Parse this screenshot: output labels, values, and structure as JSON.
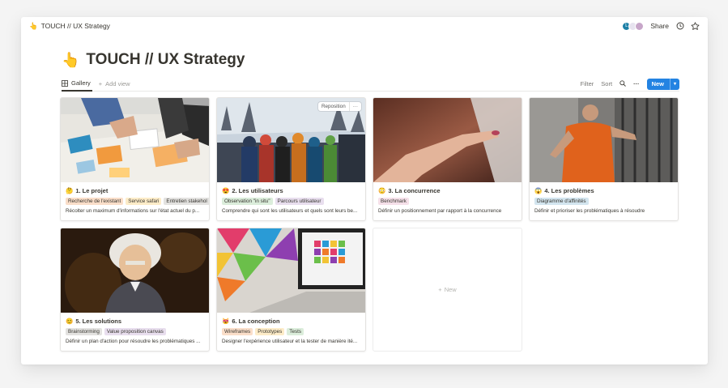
{
  "topbar": {
    "breadcrumb_emoji": "👆",
    "breadcrumb": "TOUCH // UX Strategy",
    "avatars": [
      "L",
      "",
      ""
    ],
    "share_label": "Share",
    "clock_icon": "clock-icon",
    "star_icon": "star-icon"
  },
  "page": {
    "emoji": "👆",
    "title": "TOUCH // UX Strategy"
  },
  "viewbar": {
    "active_tab": "Gallery",
    "add_view": "Add view",
    "filter": "Filter",
    "sort": "Sort",
    "new_label": "New"
  },
  "cards": [
    {
      "emoji": "🤔",
      "title": "1. Le projet",
      "tags": [
        {
          "label": "Recherche de l'existant",
          "color": "orange"
        },
        {
          "label": "Service safari",
          "color": "yellow"
        },
        {
          "label": "Entretien stakehol",
          "color": "gray"
        }
      ],
      "desc": "Récolter un maximum d'informations sur l'état actuel du p..."
    },
    {
      "emoji": "😍",
      "title": "2. Les utilisateurs",
      "tags": [
        {
          "label": "Observation \"in situ\"",
          "color": "green"
        },
        {
          "label": "Parcours utilisateur",
          "color": "purple"
        }
      ],
      "desc": "Comprendre qui sont les utilisateurs et quels sont leurs be...",
      "reposition": "Reposition"
    },
    {
      "emoji": "😳",
      "title": "3. La concurrence",
      "tags": [
        {
          "label": "Benchmark",
          "color": "pink"
        }
      ],
      "desc": "Définir un positionnement par rapport à la concurrence"
    },
    {
      "emoji": "😱",
      "title": "4. Les problèmes",
      "tags": [
        {
          "label": "Diagramme d'affinités",
          "color": "blue"
        }
      ],
      "desc": "Définir et prioriser les problématiques à résoudre"
    },
    {
      "emoji": "😊",
      "title": "5. Les solutions",
      "tags": [
        {
          "label": "Brainstorming",
          "color": "gray"
        },
        {
          "label": "Value proposition canvas",
          "color": "purple"
        }
      ],
      "desc": "Définir un plan d'action pour résoudre les problématiques ..."
    },
    {
      "emoji": "😻",
      "title": "6. La conception",
      "tags": [
        {
          "label": "Wireframes",
          "color": "orange"
        },
        {
          "label": "Prototypes",
          "color": "yellow"
        },
        {
          "label": "Tests",
          "color": "green"
        }
      ],
      "desc": "Designer l'expérience utilisateur et la tester de manière ité..."
    }
  ],
  "new_card": "New"
}
